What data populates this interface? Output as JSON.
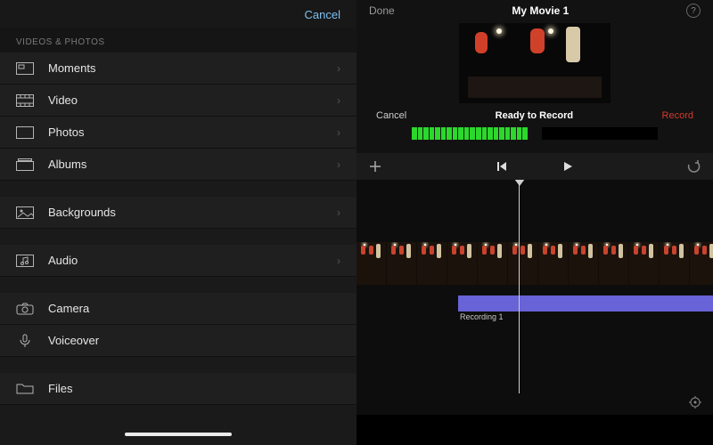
{
  "sidebar": {
    "cancel_label": "Cancel",
    "section_label": "VIDEOS & PHOTOS",
    "items": [
      {
        "label": "Moments",
        "chevron": true
      },
      {
        "label": "Video",
        "chevron": true
      },
      {
        "label": "Photos",
        "chevron": true
      },
      {
        "label": "Albums",
        "chevron": true
      },
      {
        "label": "Backgrounds",
        "chevron": true
      },
      {
        "label": "Audio",
        "chevron": true
      },
      {
        "label": "Camera",
        "chevron": false
      },
      {
        "label": "Voiceover",
        "chevron": false
      },
      {
        "label": "Files",
        "chevron": false
      }
    ]
  },
  "editor": {
    "done_label": "Done",
    "project_title": "My Movie 1",
    "help_glyph": "?",
    "record": {
      "cancel_label": "Cancel",
      "status_label": "Ready to Record",
      "record_label": "Record"
    },
    "audio_clip_label": "Recording 1"
  }
}
